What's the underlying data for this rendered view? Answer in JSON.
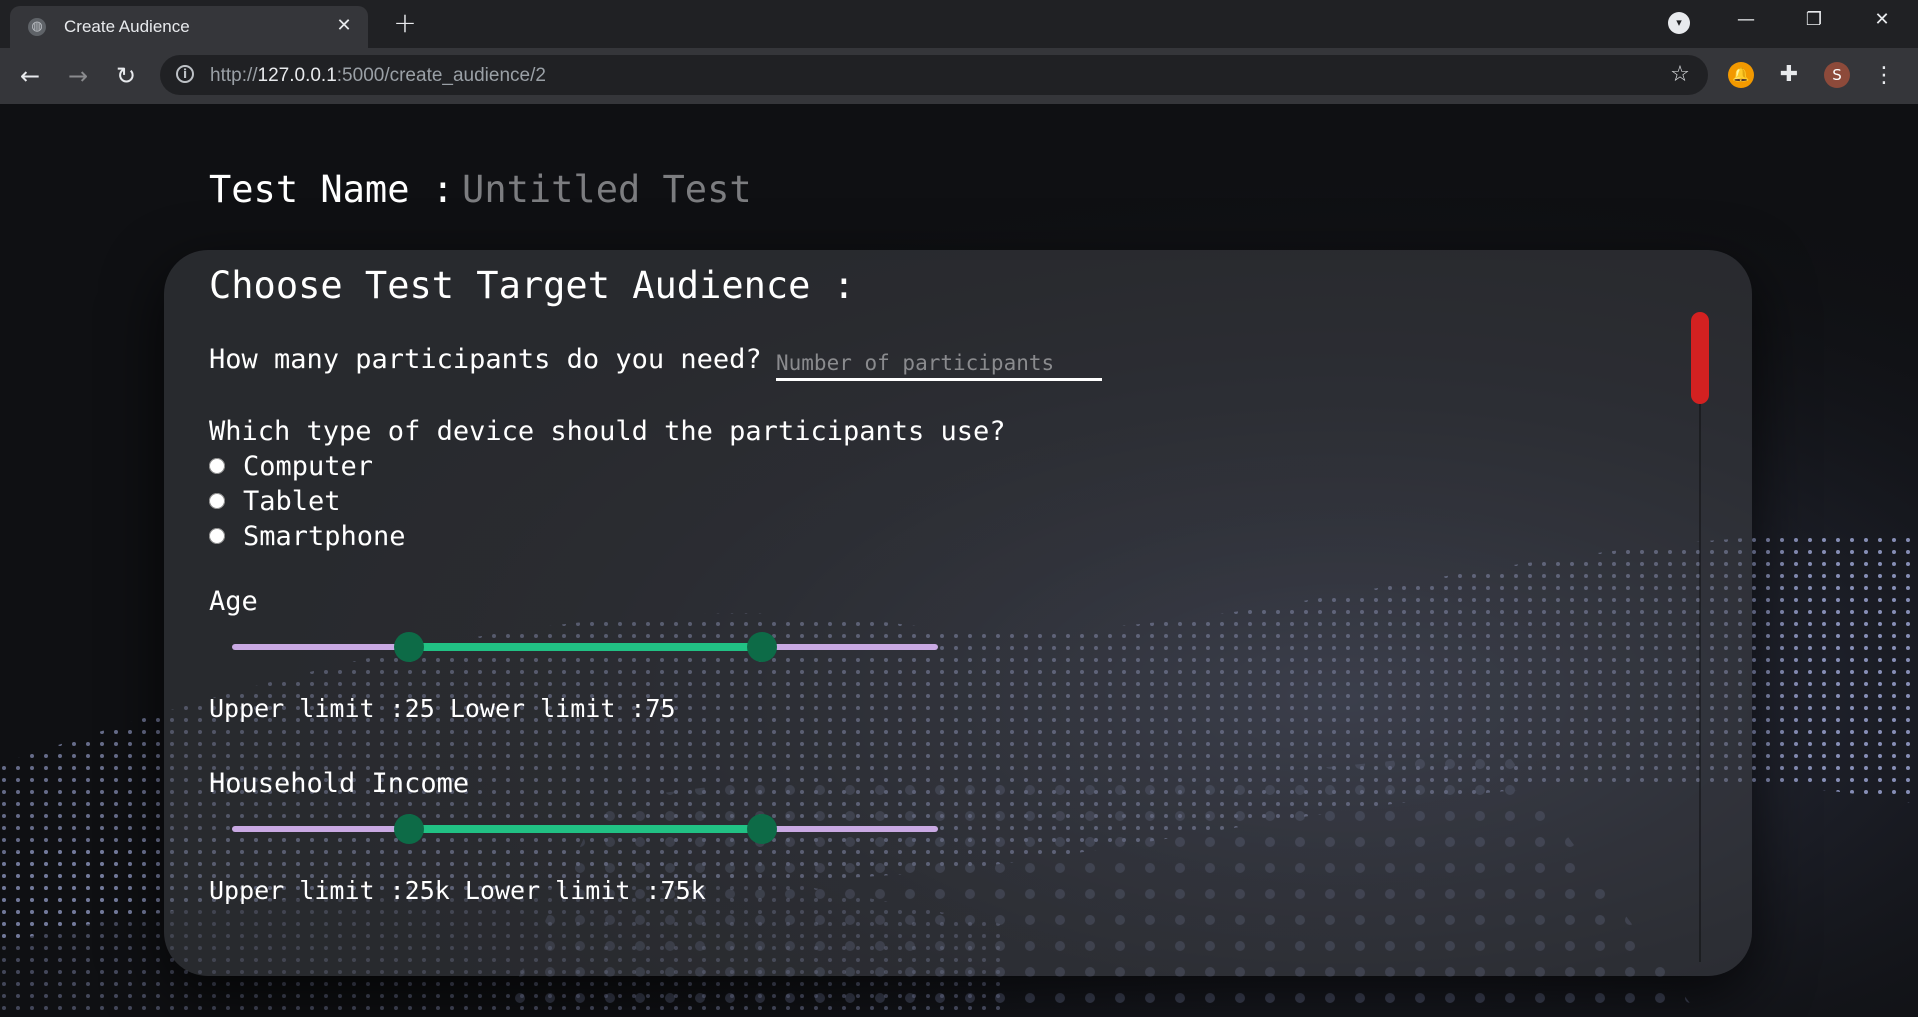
{
  "browser": {
    "tab_title": "Create Audience",
    "tab_close": "✕",
    "new_tab": "+",
    "url_scheme": "http://",
    "url_host": "127.0.0.1",
    "url_rest": ":5000/create_audience/2",
    "avatar_letter": "S",
    "icons": {
      "back": "←",
      "forward": "→",
      "reload": "↻",
      "star": "☆",
      "minimize": "—",
      "restore": "❐",
      "close": "✕",
      "menu": "⋮",
      "tab_search": "▾",
      "puzzle": "✚",
      "bell": "🔔",
      "info": "i",
      "globe": "◍"
    }
  },
  "page": {
    "test_name_label": "Test Name :",
    "test_name_value": "Untitled Test",
    "card_title": "Choose Test Target Audience :",
    "participants_question": "How many participants do you need?",
    "participants_placeholder": "Number of participants",
    "device_question": "Which type of device should the participants use?",
    "devices": [
      "Computer",
      "Tablet",
      "Smartphone"
    ],
    "age": {
      "label": "Age",
      "slider_low": 0.25,
      "slider_high": 0.75,
      "limits_text": "Upper limit :25 Lower limit :75"
    },
    "income": {
      "label": "Household Income",
      "slider_low": 0.25,
      "slider_high": 0.75,
      "limits_text": "Upper limit :25k Lower limit :75k"
    }
  },
  "colors": {
    "slider_track": "#c9a9e3",
    "slider_range": "#21c184",
    "slider_thumb": "#0d6b47",
    "scrollbar": "#d32121"
  }
}
